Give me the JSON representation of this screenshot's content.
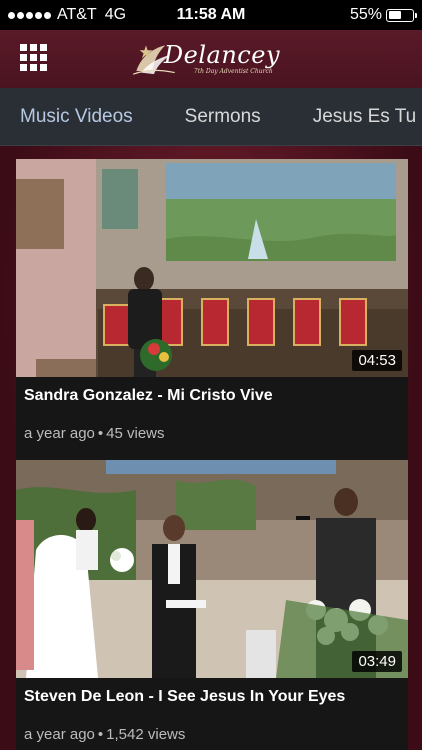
{
  "status_bar": {
    "carrier": "AT&T",
    "network": "4G",
    "time": "11:58 AM",
    "battery": "55%",
    "battery_level": 0.55
  },
  "header": {
    "logo_title": "Delancey",
    "logo_subtitle": "7th Day Adventist Church"
  },
  "tabs": [
    {
      "label": "Music Videos",
      "active": true
    },
    {
      "label": "Sermons",
      "active": false
    },
    {
      "label": "Jesus Es Tu",
      "active": false
    }
  ],
  "videos": [
    {
      "title": "Sandra Gonzalez - Mi Cristo Vive",
      "duration": "04:53",
      "age": "a year ago",
      "views": "45 views"
    },
    {
      "title": "Steven De Leon - I See Jesus In Your Eyes",
      "duration": "03:49",
      "age": "a year ago",
      "views": "1,542 views"
    }
  ],
  "colors": {
    "background": "#4a1520",
    "tab_bar": "#2a2f36",
    "active_tab": "#b6c8e2",
    "card": "#161616"
  }
}
